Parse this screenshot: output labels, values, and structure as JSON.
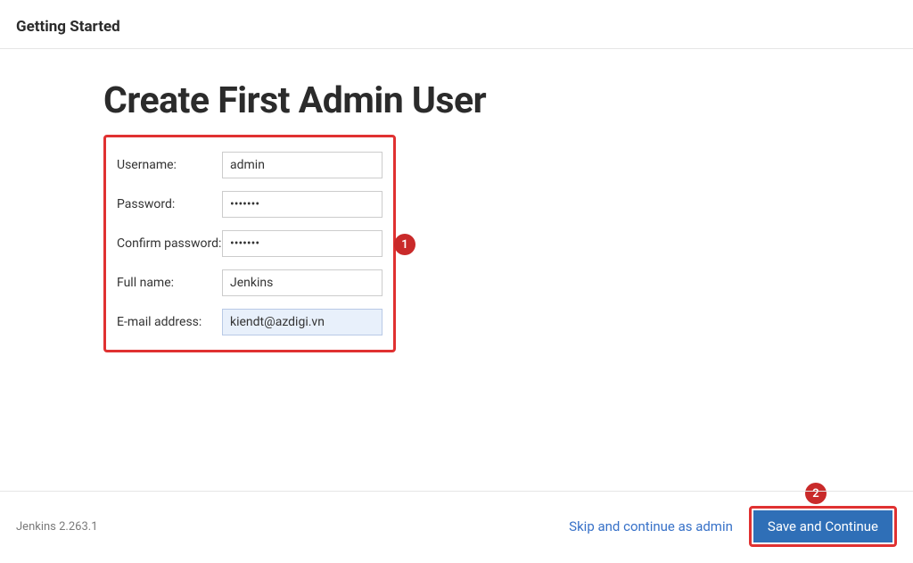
{
  "header": {
    "title": "Getting Started"
  },
  "page": {
    "title": "Create First Admin User"
  },
  "form": {
    "username": {
      "label": "Username:",
      "value": "admin"
    },
    "password": {
      "label": "Password:",
      "value": "•••••••"
    },
    "confirm": {
      "label": "Confirm password:",
      "value": "•••••••"
    },
    "fullname": {
      "label": "Full name:",
      "value": "Jenkins"
    },
    "email": {
      "label": "E-mail address:",
      "value": "kiendt@azdigi.vn"
    }
  },
  "callouts": {
    "one": "1",
    "two": "2"
  },
  "footer": {
    "version": "Jenkins 2.263.1",
    "skip_label": "Skip and continue as admin",
    "save_label": "Save and Continue"
  }
}
